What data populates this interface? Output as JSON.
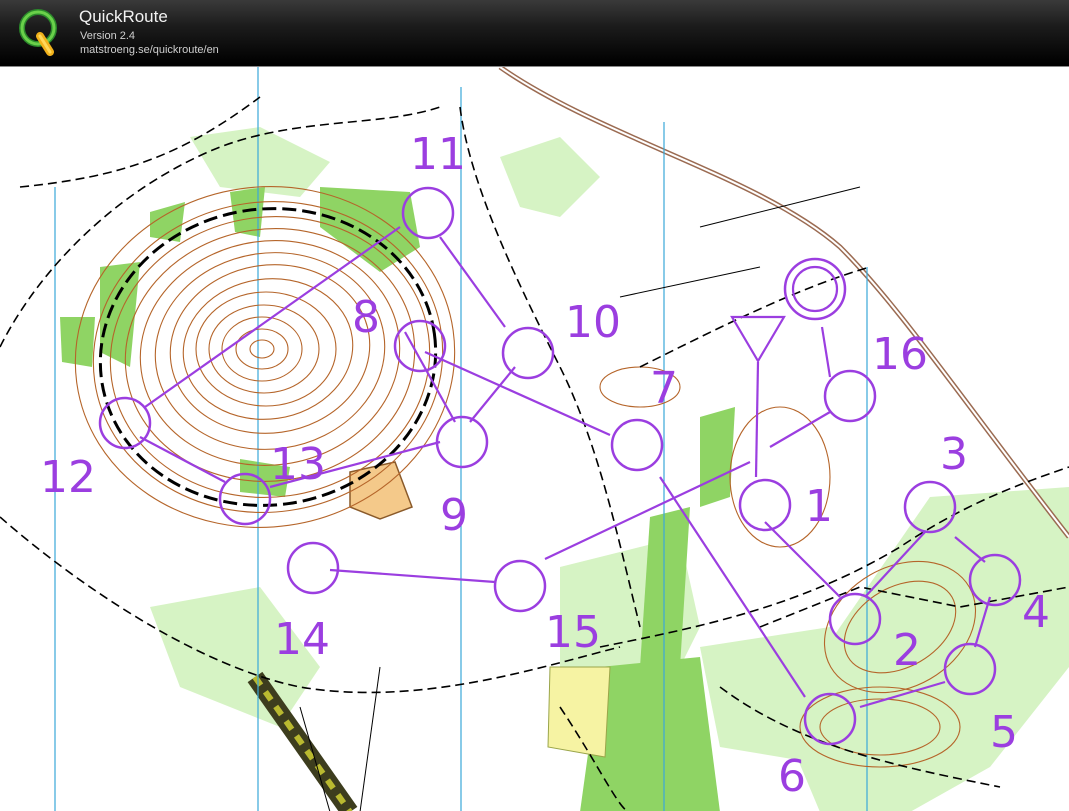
{
  "app": {
    "title": "QuickRoute",
    "version": "Version 2.4",
    "url": "matstroeng.se/quickroute/en",
    "logo_icon": "quickroute-q-logo-icon"
  },
  "map": {
    "course_color": "#9b3ee0",
    "contour_color": "#b5652a",
    "vegetation_color": "#8fd464",
    "start_label": "",
    "controls": [
      {
        "label": "1"
      },
      {
        "label": "2"
      },
      {
        "label": "3"
      },
      {
        "label": "4"
      },
      {
        "label": "5"
      },
      {
        "label": "6"
      },
      {
        "label": "7"
      },
      {
        "label": "8"
      },
      {
        "label": "9"
      },
      {
        "label": "10"
      },
      {
        "label": "11"
      },
      {
        "label": "12"
      },
      {
        "label": "13"
      },
      {
        "label": "14"
      },
      {
        "label": "15"
      },
      {
        "label": "16"
      }
    ]
  }
}
